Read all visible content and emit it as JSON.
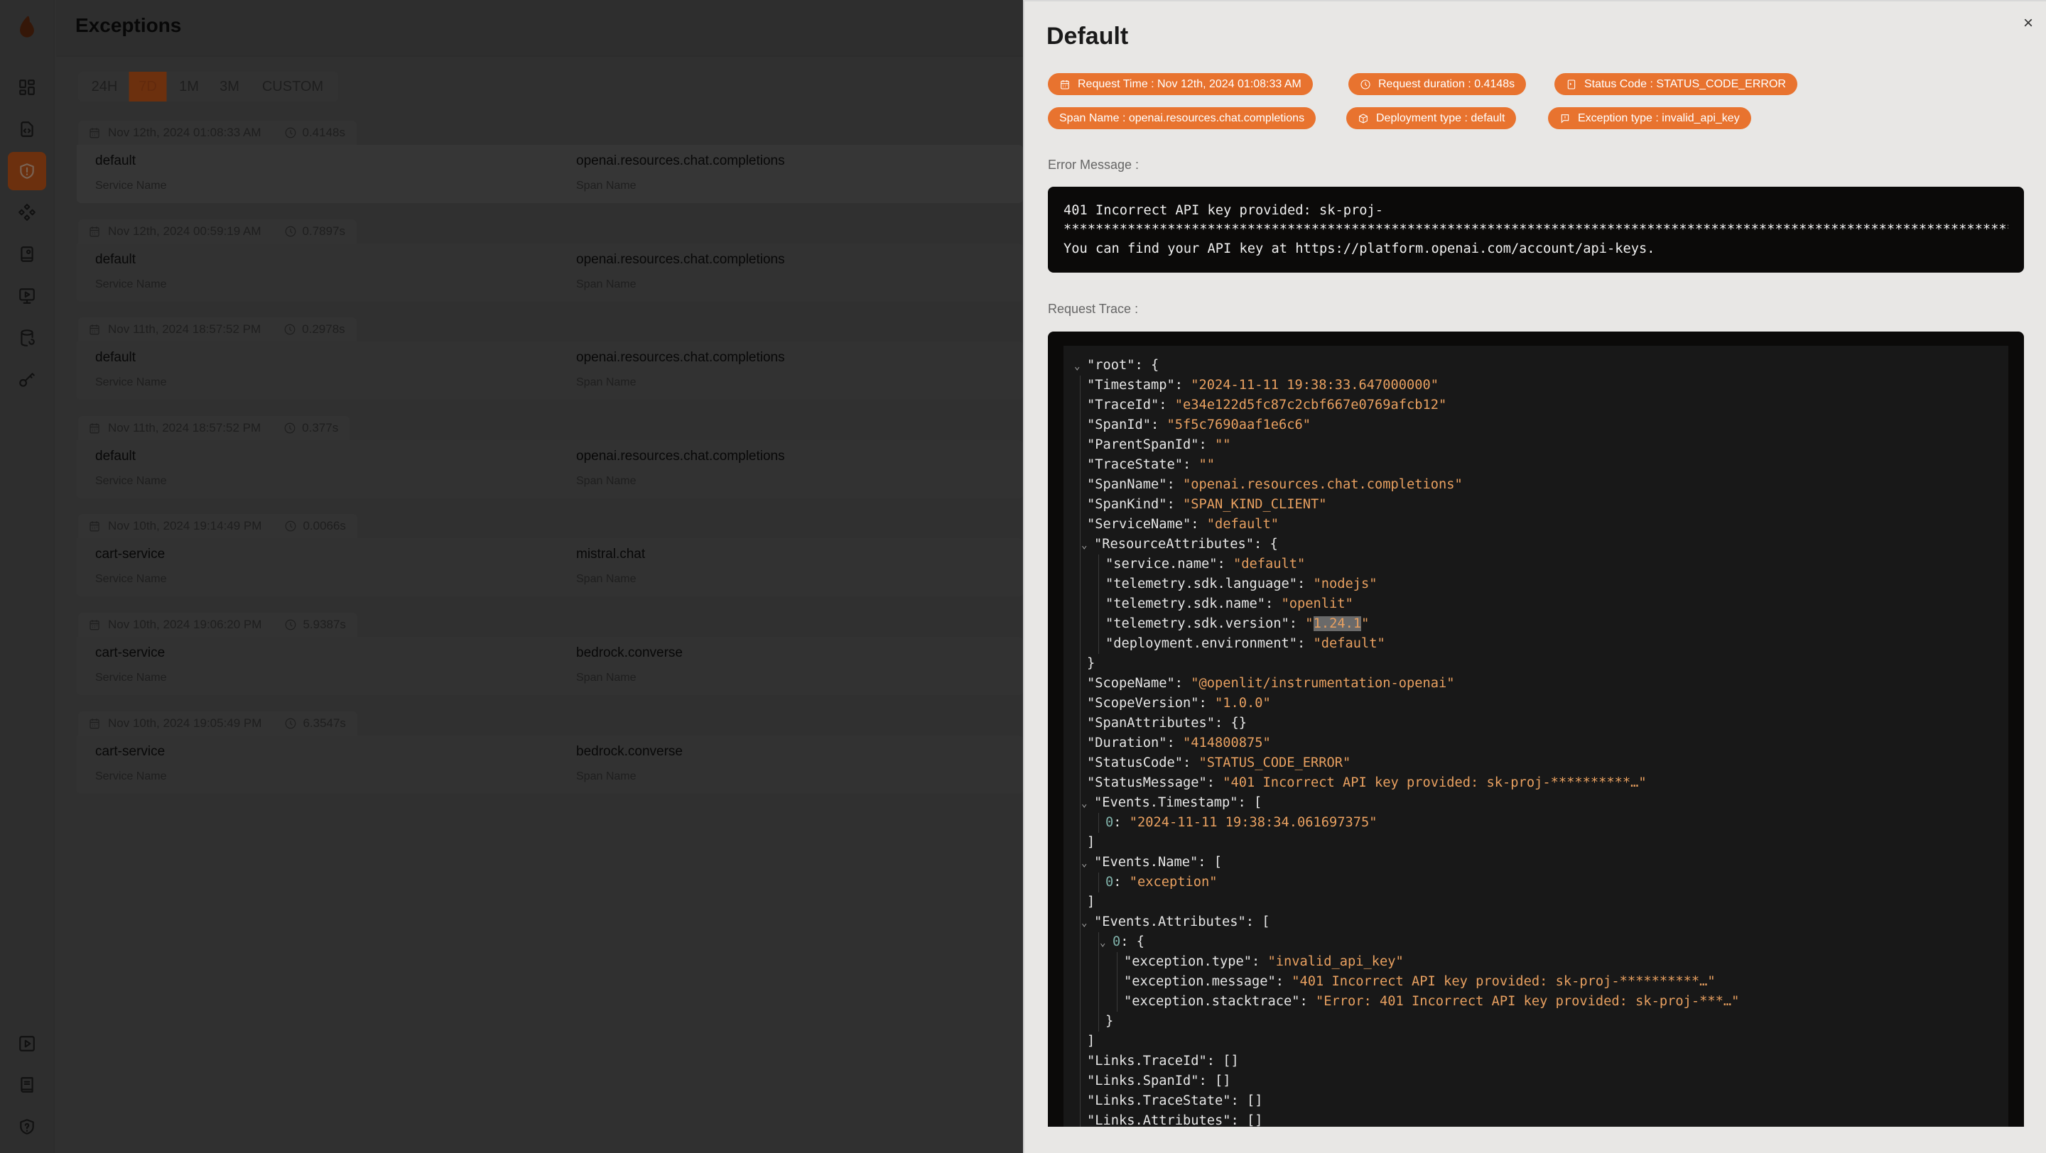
{
  "app": {
    "page_title": "Exceptions",
    "sidebar": {
      "items": [
        {
          "name": "logo-icon"
        },
        {
          "name": "dashboard-icon"
        },
        {
          "name": "requests-icon"
        },
        {
          "name": "exceptions-icon",
          "active": true
        },
        {
          "name": "prompts-icon"
        },
        {
          "name": "vault-icon"
        },
        {
          "name": "openground-icon"
        },
        {
          "name": "database-config-icon"
        },
        {
          "name": "api-keys-icon"
        }
      ],
      "bottom_items": [
        {
          "name": "play-icon"
        },
        {
          "name": "docs-icon"
        },
        {
          "name": "help-shield-icon"
        }
      ]
    },
    "time_tabs": {
      "options": [
        "24H",
        "7D",
        "1M",
        "3M",
        "CUSTOM"
      ],
      "selected": "7D"
    },
    "list": {
      "service_label": "Service Name",
      "span_label": "Span Name",
      "items": [
        {
          "time": "Nov 12th, 2024 01:08:33 AM",
          "duration": "0.4148s",
          "service": "default",
          "span": "openai.resources.chat.completions"
        },
        {
          "time": "Nov 12th, 2024 00:59:19 AM",
          "duration": "0.7897s",
          "service": "default",
          "span": "openai.resources.chat.completions"
        },
        {
          "time": "Nov 11th, 2024 18:57:52 PM",
          "duration": "0.2978s",
          "service": "default",
          "span": "openai.resources.chat.completions"
        },
        {
          "time": "Nov 11th, 2024 18:57:52 PM",
          "duration": "0.377s",
          "service": "default",
          "span": "openai.resources.chat.completions"
        },
        {
          "time": "Nov 10th, 2024 19:14:49 PM",
          "duration": "0.0066s",
          "service": "cart-service",
          "span": "mistral.chat"
        },
        {
          "time": "Nov 10th, 2024 19:06:20 PM",
          "duration": "5.9387s",
          "service": "cart-service",
          "span": "bedrock.converse"
        },
        {
          "time": "Nov 10th, 2024 19:05:49 PM",
          "duration": "6.3547s",
          "service": "cart-service",
          "span": "bedrock.converse"
        }
      ]
    }
  },
  "drawer": {
    "title": "Default",
    "close_label": "×",
    "badges": [
      {
        "icon": "calendar-icon",
        "text": "Request Time : Nov 12th, 2024 01:08:33 AM"
      },
      {
        "icon": "clock-icon",
        "text": "Request duration : 0.4148s"
      },
      {
        "icon": "status-icon",
        "text": "Status Code : STATUS_CODE_ERROR"
      },
      {
        "icon": "",
        "text": "Span Name : openai.resources.chat.completions"
      },
      {
        "icon": "deployment-icon",
        "text": "Deployment type : default"
      },
      {
        "icon": "message-alert-icon",
        "text": "Exception type : invalid_api_key"
      }
    ],
    "error_label": "Error Message :",
    "error_lines": [
      "401 Incorrect API key provided: sk-proj-",
      "**************************************************************************************************************************************",
      "You can find your API key at https://platform.openai.com/account/api-keys."
    ],
    "trace_label": "Request Trace :",
    "trace_lines": [
      {
        "d": 0,
        "toggle": true,
        "k": "\"root\"",
        "v": "{",
        "t": "punct"
      },
      {
        "d": 1,
        "k": "\"Timestamp\"",
        "v": "\"2024-11-11 19:38:33.647000000\"",
        "t": "str"
      },
      {
        "d": 1,
        "k": "\"TraceId\"",
        "v": "\"e34e122d5fc87c2cbf667e0769afcb12\"",
        "t": "str"
      },
      {
        "d": 1,
        "k": "\"SpanId\"",
        "v": "\"5f5c7690aaf1e6c6\"",
        "t": "str"
      },
      {
        "d": 1,
        "k": "\"ParentSpanId\"",
        "v": "\"\"",
        "t": "str"
      },
      {
        "d": 1,
        "k": "\"TraceState\"",
        "v": "\"\"",
        "t": "str"
      },
      {
        "d": 1,
        "k": "\"SpanName\"",
        "v": "\"openai.resources.chat.completions\"",
        "t": "str"
      },
      {
        "d": 1,
        "k": "\"SpanKind\"",
        "v": "\"SPAN_KIND_CLIENT\"",
        "t": "str"
      },
      {
        "d": 1,
        "k": "\"ServiceName\"",
        "v": "\"default\"",
        "t": "str"
      },
      {
        "d": 1,
        "toggle": true,
        "k": "\"ResourceAttributes\"",
        "v": "{",
        "t": "punct"
      },
      {
        "d": 2,
        "k": "\"service.name\"",
        "v": "\"default\"",
        "t": "str"
      },
      {
        "d": 2,
        "k": "\"telemetry.sdk.language\"",
        "v": "\"nodejs\"",
        "t": "str"
      },
      {
        "d": 2,
        "k": "\"telemetry.sdk.name\"",
        "v": "\"openlit\"",
        "t": "str"
      },
      {
        "d": 2,
        "k": "\"telemetry.sdk.version\"",
        "v": "\"1.24.1\"",
        "t": "str",
        "selected": "1.24.1"
      },
      {
        "d": 2,
        "k": "\"deployment.environment\"",
        "v": "\"default\"",
        "t": "str"
      },
      {
        "d": 1,
        "v": "}",
        "t": "punct"
      },
      {
        "d": 1,
        "k": "\"ScopeName\"",
        "v": "\"@openlit/instrumentation-openai\"",
        "t": "str"
      },
      {
        "d": 1,
        "k": "\"ScopeVersion\"",
        "v": "\"1.0.0\"",
        "t": "str"
      },
      {
        "d": 1,
        "k": "\"SpanAttributes\"",
        "v": "{}",
        "t": "punct"
      },
      {
        "d": 1,
        "k": "\"Duration\"",
        "v": "\"414800875\"",
        "t": "str"
      },
      {
        "d": 1,
        "k": "\"StatusCode\"",
        "v": "\"STATUS_CODE_ERROR\"",
        "t": "str"
      },
      {
        "d": 1,
        "k": "\"StatusMessage\"",
        "v": "\"401 Incorrect API key provided: sk-proj-**********…\"",
        "t": "str"
      },
      {
        "d": 1,
        "toggle": true,
        "k": "\"Events.Timestamp\"",
        "v": "[",
        "t": "punct"
      },
      {
        "d": 2,
        "k": "0",
        "kt": "idx",
        "v": "\"2024-11-11 19:38:34.061697375\"",
        "t": "str"
      },
      {
        "d": 1,
        "v": "]",
        "t": "punct"
      },
      {
        "d": 1,
        "toggle": true,
        "k": "\"Events.Name\"",
        "v": "[",
        "t": "punct"
      },
      {
        "d": 2,
        "k": "0",
        "kt": "idx",
        "v": "\"exception\"",
        "t": "str"
      },
      {
        "d": 1,
        "v": "]",
        "t": "punct"
      },
      {
        "d": 1,
        "toggle": true,
        "k": "\"Events.Attributes\"",
        "v": "[",
        "t": "punct"
      },
      {
        "d": 2,
        "toggle": true,
        "k": "0",
        "kt": "idx",
        "v": "{",
        "t": "punct"
      },
      {
        "d": 3,
        "k": "\"exception.type\"",
        "v": "\"invalid_api_key\"",
        "t": "str"
      },
      {
        "d": 3,
        "k": "\"exception.message\"",
        "v": "\"401 Incorrect API key provided: sk-proj-**********…\"",
        "t": "str"
      },
      {
        "d": 3,
        "k": "\"exception.stacktrace\"",
        "v": "\"Error: 401 Incorrect API key provided: sk-proj-***…\"",
        "t": "str"
      },
      {
        "d": 2,
        "v": "}",
        "t": "punct"
      },
      {
        "d": 1,
        "v": "]",
        "t": "punct"
      },
      {
        "d": 1,
        "k": "\"Links.TraceId\"",
        "v": "[]",
        "t": "punct"
      },
      {
        "d": 1,
        "k": "\"Links.SpanId\"",
        "v": "[]",
        "t": "punct"
      },
      {
        "d": 1,
        "k": "\"Links.TraceState\"",
        "v": "[]",
        "t": "punct"
      },
      {
        "d": 1,
        "k": "\"Links.Attributes\"",
        "v": "[]",
        "t": "punct"
      }
    ]
  },
  "colors": {
    "accent": "#e8732f",
    "drawer_bg": "#e8e7e5",
    "code_bg": "#0b0a09",
    "json_string": "#e8a060",
    "json_index": "#7fb0a8"
  }
}
